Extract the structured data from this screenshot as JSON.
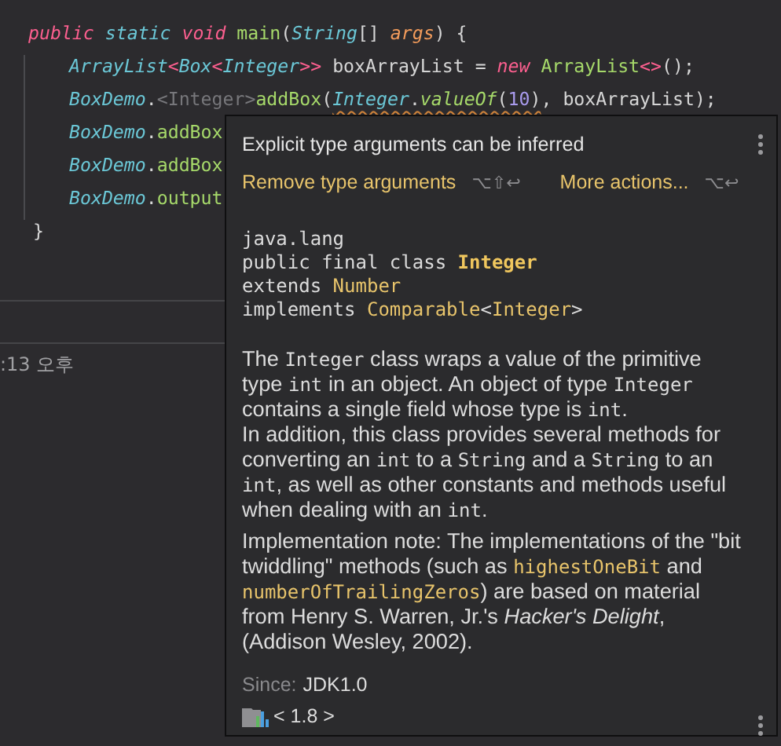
{
  "editor": {
    "lines": [
      {
        "tokens": [
          {
            "text": "public ",
            "kind": "kw"
          },
          {
            "text": "static ",
            "kind": "type"
          },
          {
            "text": "void ",
            "kind": "kw"
          },
          {
            "text": "main",
            "kind": "fn"
          },
          {
            "text": "(",
            "kind": "plain"
          },
          {
            "text": "String",
            "kind": "type"
          },
          {
            "text": "[] ",
            "kind": "plain"
          },
          {
            "text": "args",
            "kind": "param"
          },
          {
            "text": ") {",
            "kind": "plain"
          }
        ],
        "children": [
          {
            "tokens": [
              {
                "text": "ArrayList",
                "kind": "type"
              },
              {
                "text": "<",
                "kind": "op"
              },
              {
                "text": "Box",
                "kind": "type"
              },
              {
                "text": "<",
                "kind": "op"
              },
              {
                "text": "Integer",
                "kind": "type"
              },
              {
                "text": ">>",
                "kind": "op"
              },
              {
                "text": " boxArrayList = ",
                "kind": "plain"
              },
              {
                "text": "new ",
                "kind": "kw"
              },
              {
                "text": "ArrayList",
                "kind": "fn"
              },
              {
                "text": "<>",
                "kind": "op"
              },
              {
                "text": "();",
                "kind": "plain"
              }
            ]
          },
          {
            "tokens": [
              {
                "text": "BoxDemo",
                "kind": "type"
              },
              {
                "text": ".",
                "kind": "plain"
              },
              {
                "text": "<Integer>",
                "kind": "hint"
              },
              {
                "text": "addBox",
                "kind": "fn"
              },
              {
                "text": "(",
                "kind": "plain"
              },
              {
                "text": "Integer",
                "kind": "type",
                "warning": true
              },
              {
                "text": ".",
                "kind": "plain",
                "warning": true
              },
              {
                "text": "valueOf",
                "kind": "fn_italic",
                "warning": true
              },
              {
                "text": "(",
                "kind": "plain",
                "warning": true
              },
              {
                "text": "10",
                "kind": "num",
                "warning": true
              },
              {
                "text": ")",
                "kind": "plain",
                "warning": true
              },
              {
                "text": ", boxArrayList);",
                "kind": "plain"
              }
            ]
          },
          {
            "tokens": [
              {
                "text": "BoxDemo",
                "kind": "type"
              },
              {
                "text": ".",
                "kind": "plain"
              },
              {
                "text": "addBox",
                "kind": "fn"
              }
            ]
          },
          {
            "tokens": [
              {
                "text": "BoxDemo",
                "kind": "type"
              },
              {
                "text": ".",
                "kind": "plain"
              },
              {
                "text": "addBox",
                "kind": "fn"
              }
            ]
          },
          {
            "tokens": [
              {
                "text": "BoxDemo",
                "kind": "type"
              },
              {
                "text": ".",
                "kind": "plain"
              },
              {
                "text": "output",
                "kind": "fn"
              }
            ]
          }
        ]
      },
      {
        "tokens": [
          {
            "text": "}",
            "kind": "plain"
          }
        ]
      }
    ]
  },
  "event_log": {
    "time": ":13 오후"
  },
  "popup": {
    "title": "Explicit type arguments can be inferred",
    "actions": [
      {
        "label": "Remove type arguments",
        "shortcut": "⌥⇧↩"
      },
      {
        "label": "More actions...",
        "shortcut": "⌥↩"
      }
    ],
    "signature": [
      [
        {
          "text": "java.lang",
          "kind": "text"
        }
      ],
      [
        {
          "text": "public final class ",
          "kind": "text"
        },
        {
          "text": "Integer",
          "kind": "name"
        }
      ],
      [
        {
          "text": "extends ",
          "kind": "text"
        },
        {
          "text": "Number",
          "kind": "link"
        }
      ],
      [
        {
          "text": "implements ",
          "kind": "text"
        },
        {
          "text": "Comparable",
          "kind": "link"
        },
        {
          "text": "<",
          "kind": "text"
        },
        {
          "text": "Integer",
          "kind": "link"
        },
        {
          "text": ">",
          "kind": "text"
        }
      ]
    ],
    "paragraphs": [
      [
        {
          "text": "The ",
          "kind": "text"
        },
        {
          "text": "Integer",
          "kind": "code"
        },
        {
          "text": " class wraps a value of the primitive type ",
          "kind": "text"
        },
        {
          "text": "int",
          "kind": "code"
        },
        {
          "text": " in an object. An object of type ",
          "kind": "text"
        },
        {
          "text": "Integer",
          "kind": "code"
        },
        {
          "text": " contains a single field whose type is ",
          "kind": "text"
        },
        {
          "text": "int",
          "kind": "code"
        },
        {
          "text": ".",
          "kind": "text"
        }
      ],
      [
        {
          "text": "In addition, this class provides several methods for converting an ",
          "kind": "text"
        },
        {
          "text": "int",
          "kind": "code"
        },
        {
          "text": " to a ",
          "kind": "text"
        },
        {
          "text": "String",
          "kind": "code"
        },
        {
          "text": " and a ",
          "kind": "text"
        },
        {
          "text": "String",
          "kind": "code"
        },
        {
          "text": " to an ",
          "kind": "text"
        },
        {
          "text": "int",
          "kind": "code"
        },
        {
          "text": ", as well as other constants and methods useful when dealing with an ",
          "kind": "text"
        },
        {
          "text": "int",
          "kind": "code"
        },
        {
          "text": ".",
          "kind": "text"
        }
      ],
      [
        {
          "text": "Implementation note: The implementations of the \"bit twiddling\" methods (such as ",
          "kind": "text"
        },
        {
          "text": "highestOneBit",
          "kind": "link"
        },
        {
          "text": " and ",
          "kind": "text"
        },
        {
          "text": "numberOfTrailingZeros",
          "kind": "link"
        },
        {
          "text": ") are based on material from Henry S. Warren, Jr.'s ",
          "kind": "text"
        },
        {
          "text": "Hacker's Delight",
          "kind": "em"
        },
        {
          "text": ", (Addison Wesley, 2002).",
          "kind": "text"
        }
      ]
    ],
    "since_label": "Since:",
    "since_value": "JDK1.0",
    "library": "< 1.8 >"
  }
}
